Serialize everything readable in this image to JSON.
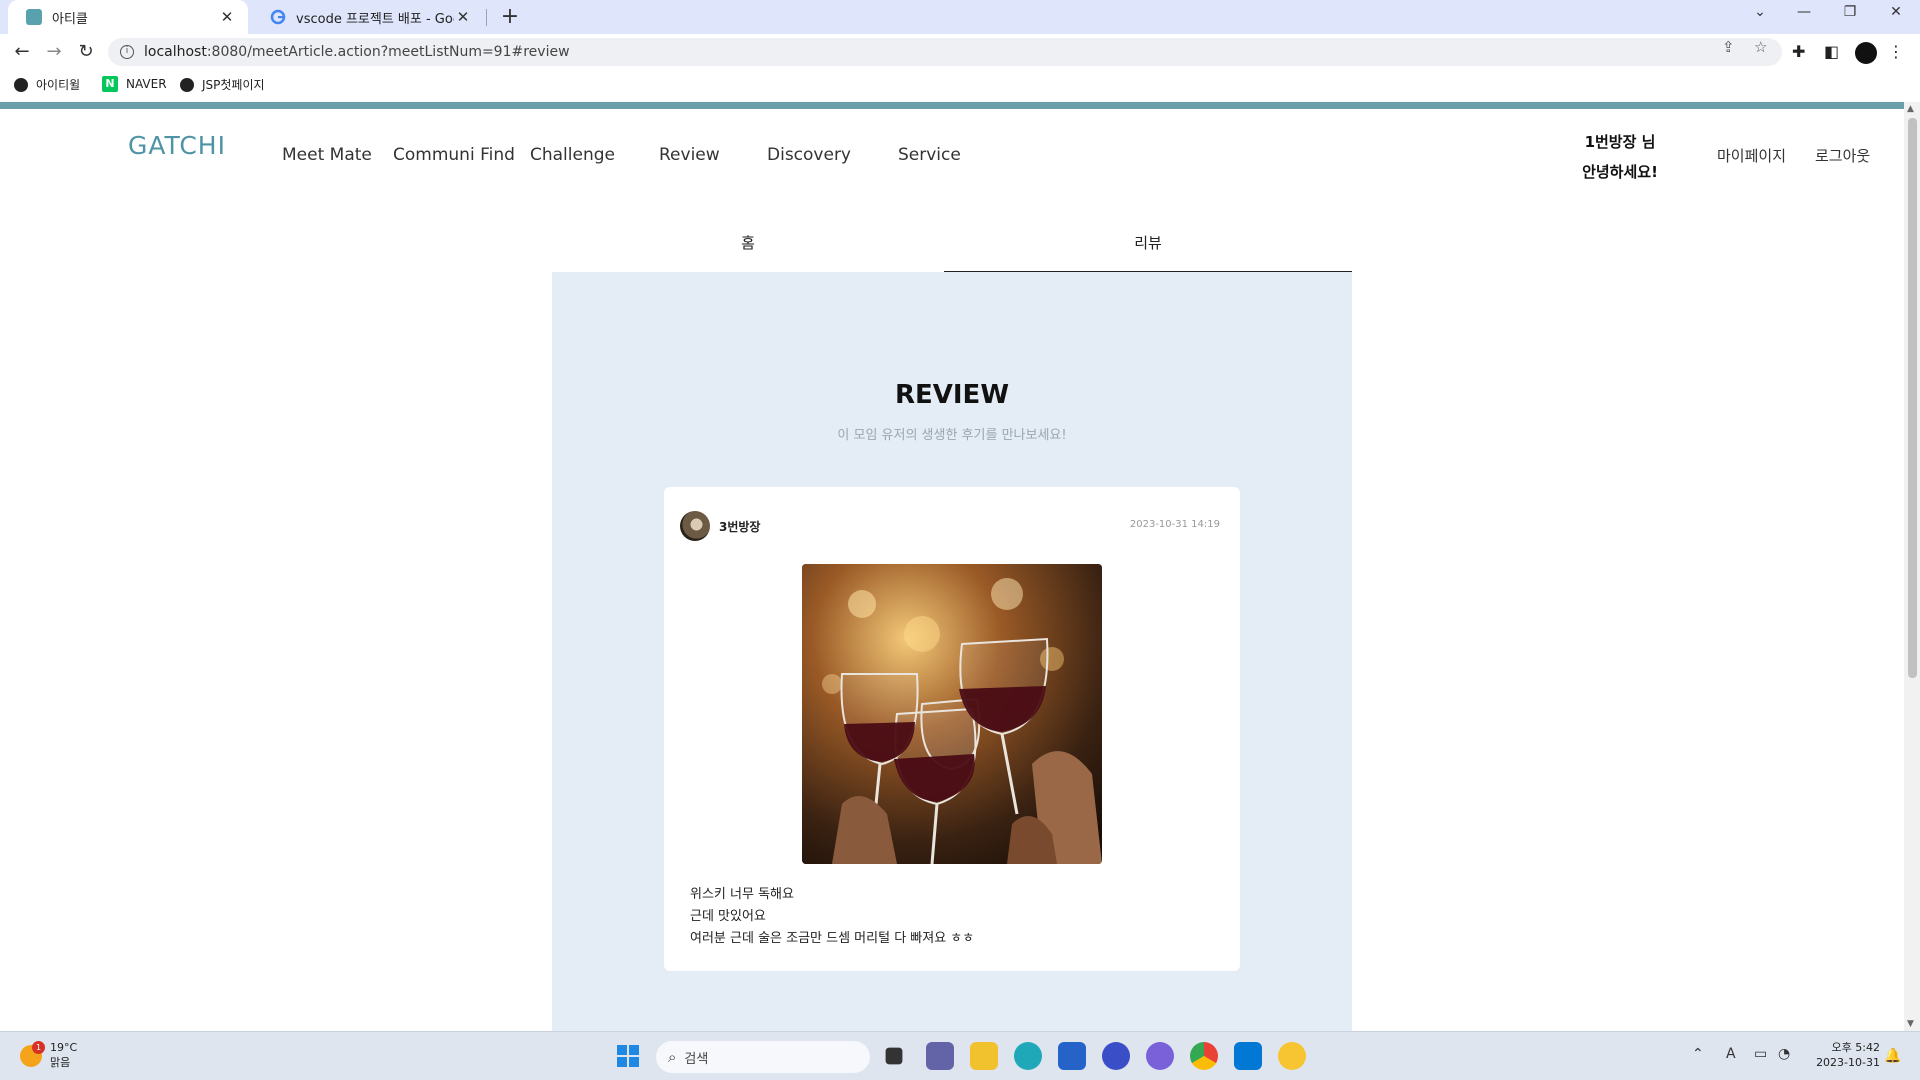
{
  "browser": {
    "tabs": [
      {
        "title": "아티클",
        "active": true
      },
      {
        "title": "vscode 프로젝트 배포 - Google",
        "active": false
      }
    ],
    "url_host": "localhost",
    "url_rest": ":8080/meetArticle.action?meetListNum=91#review",
    "bookmarks": [
      "아이티윌",
      "NAVER",
      "JSP첫페이지"
    ]
  },
  "header": {
    "logo": "GATCHI",
    "nav": [
      "Meet Mate",
      "Communi Find",
      "Challenge",
      "Review",
      "Discovery",
      "Service"
    ],
    "greeting_line1": "1번방장 님",
    "greeting_line2": "안녕하세요!",
    "mypage": "마이페이지",
    "logout": "로그아웃"
  },
  "tabs": {
    "home": "홈",
    "review": "리뷰",
    "active": "review"
  },
  "review_section": {
    "title": "REVIEW",
    "subtitle": "이 모임 유저의 생생한 후기를 만나보세요!",
    "card": {
      "author": "3번방장",
      "date": "2023-10-31 14:19",
      "image_subject": "wine glasses toasting",
      "lines": [
        "위스키 너무 독해요",
        "근데 맛있어요",
        "여러분 근데 술은 조금만 드셈 머리털 다 빠져요 ㅎㅎ"
      ]
    }
  },
  "taskbar": {
    "weather_temp": "19°C",
    "weather_desc": "맑음",
    "weather_badge": "1",
    "search_placeholder": "검색",
    "clock_time": "오후 5:42",
    "clock_date": "2023-10-31"
  },
  "colors": {
    "accent": "#4f93a6",
    "section_bg": "#e4edf5",
    "top_bar": "#6a9ea8"
  }
}
